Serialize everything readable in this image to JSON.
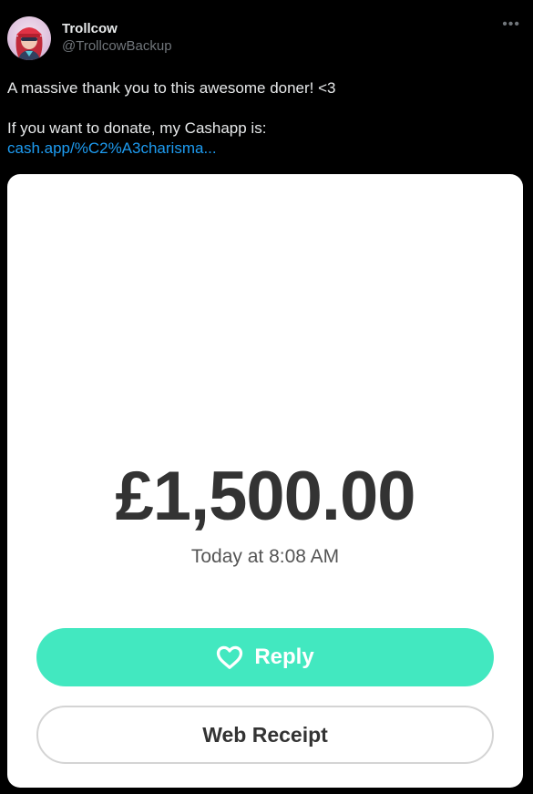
{
  "author": {
    "display_name": "Trollcow",
    "handle": "@TrollcowBackup",
    "avatar_icon": "avatar-illustration-red-cap"
  },
  "post": {
    "line1": "A massive thank you to this awesome doner! <3",
    "line2": "If you want to donate, my Cashapp is:",
    "link_text": "cash.app/%C2%A3charisma..."
  },
  "more_icon": "more-options-icon",
  "receipt": {
    "amount": "£1,500.00",
    "date": "Today at 8:08 AM",
    "reply_label": "Reply",
    "web_receipt_label": "Web Receipt",
    "reply_color": "#42e8c0"
  },
  "colors": {
    "background": "#000000",
    "text": "#e7e9ea",
    "secondary": "#71767b",
    "link": "#1d9bf0"
  }
}
